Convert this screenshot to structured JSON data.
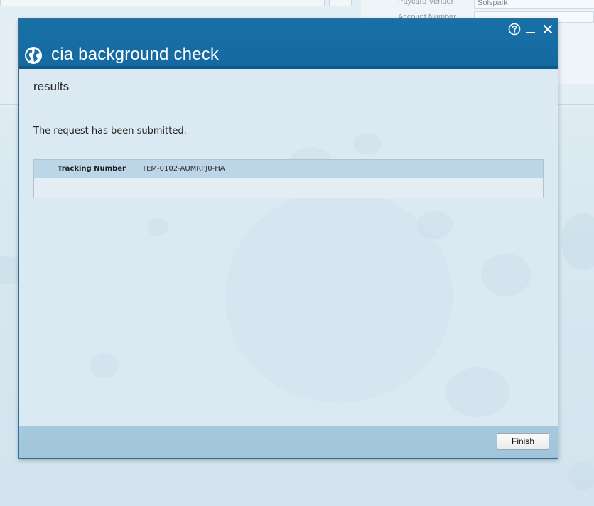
{
  "background": {
    "field_label_1": "Paycard Vendor",
    "field_value_1": "Solspark",
    "field_label_2": "Account Number"
  },
  "dialog": {
    "title": "cia background check",
    "icons": {
      "app": "globe-icon",
      "help": "help-icon",
      "minimize": "minimize-icon",
      "close": "close-icon",
      "resize": "resize-grip-icon"
    },
    "section_heading": "results",
    "message": "The request has been submitted.",
    "results": [
      {
        "label": "Tracking Number",
        "value": "TEM-0102-AUMRPJ0-HA"
      }
    ],
    "footer": {
      "finish_label": "Finish"
    }
  },
  "colors": {
    "titlebar": "#1870a6",
    "content_bg": "#dbe9f2",
    "row_highlight": "#bcd6e7",
    "footer_bg": "#a7c9de"
  }
}
